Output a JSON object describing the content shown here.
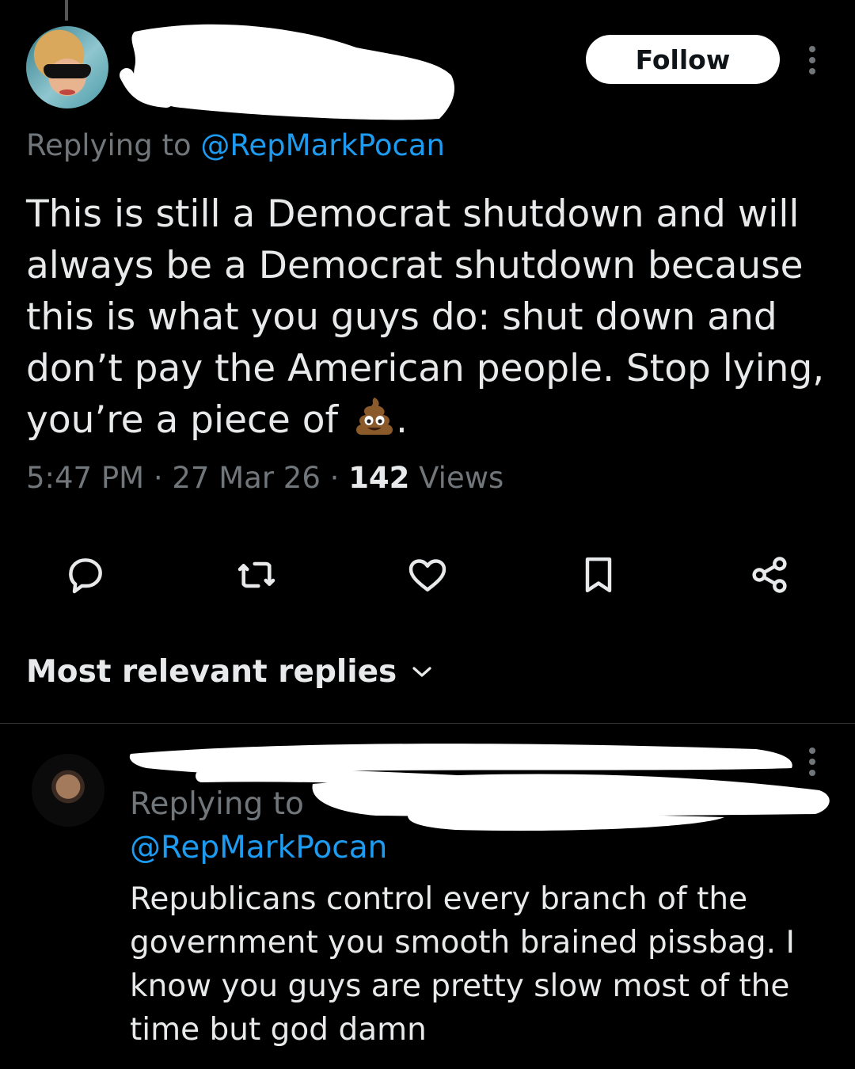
{
  "tweet": {
    "replying_prefix": "Replying to ",
    "replying_handle": "@RepMarkPocan",
    "text": "This is still a Democrat shutdown and will always be a Democrat shutdown because this is what you guys do: shut down and don’t pay the American people. Stop lying, you’re a piece of",
    "text_suffix": ".",
    "emoji_icon": "poop-emoji-icon",
    "time": "5:47 PM",
    "separator": " · ",
    "date": "27 Mar 26",
    "view_count": "142",
    "views_label": " Views",
    "follow_label": "Follow"
  },
  "actions": [
    "reply-icon",
    "retweet-icon",
    "like-icon",
    "bookmark-icon",
    "share-icon"
  ],
  "replies_header": {
    "label": "Most relevant replies",
    "icon": "chevron-down-icon"
  },
  "reply": {
    "replying_prefix": "Replying to",
    "replying_handle": "@RepMarkPocan",
    "text": "Republicans control every branch of the government you smooth brained pissbag. I know you guys are pretty slow most of the time but god damn"
  },
  "colors": {
    "background": "#000000",
    "text": "#e7e9ea",
    "secondary": "#71767b",
    "accent": "#1d9bf0"
  }
}
